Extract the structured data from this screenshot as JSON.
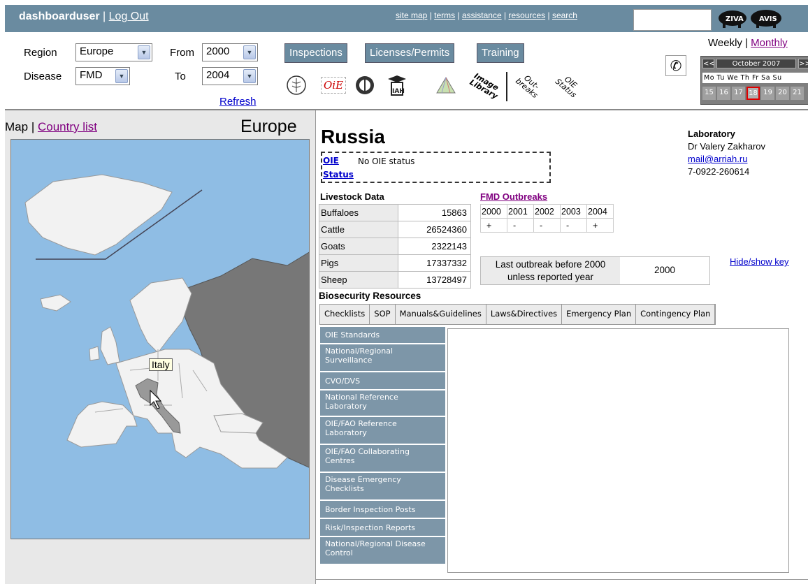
{
  "header": {
    "username": "dashboarduser",
    "separator": "|",
    "logout": "Log Out",
    "links": [
      "site map",
      "terms",
      "assistance",
      "resources",
      "search"
    ],
    "logo_text_1": "ZIVA",
    "logo_text_2": "AVIS"
  },
  "filters": {
    "region_label": "Region",
    "region_value": "Europe",
    "disease_label": "Disease",
    "disease_value": "FMD",
    "from_label": "From",
    "from_value": "2000",
    "to_label": "To",
    "to_value": "2004",
    "refresh": "Refresh"
  },
  "tabs": [
    "Inspections",
    "Licenses/Permits",
    "Training"
  ],
  "icon_labels": {
    "fao": "FAO",
    "oie": "OiE",
    "who": "WHO",
    "iah": "IAH",
    "image_library": "Image Library",
    "outbreaks": "Out-breaks",
    "oie_status": "OIE Status"
  },
  "calendar": {
    "weekly": "Weekly",
    "sep": "|",
    "monthly": "Monthly",
    "prev": "<<",
    "next": ">>",
    "month": "October 2007",
    "dow": "Mo Tu We Th Fr Sa Su",
    "days": [
      "15",
      "16",
      "17",
      "18",
      "19",
      "20",
      "21"
    ],
    "today_index": 3
  },
  "map_panel": {
    "map_label": "Map",
    "sep": "|",
    "country_list": "Country list",
    "region_title": "Europe",
    "tooltip": "Italy"
  },
  "country": {
    "name": "Russia",
    "oie_link": "OIE",
    "status_link": "Status",
    "oie_status": "No OIE status"
  },
  "laboratory": {
    "title": "Laboratory",
    "person": "Dr Valery Zakharov",
    "email": "mail@arriah.ru",
    "phone": "7-0922-260614"
  },
  "livestock": {
    "title": "Livestock Data",
    "rows": [
      {
        "name": "Buffaloes",
        "value": "15863"
      },
      {
        "name": "Cattle",
        "value": "26524360"
      },
      {
        "name": "Goats",
        "value": "2322143"
      },
      {
        "name": "Pigs",
        "value": "17337332"
      },
      {
        "name": "Sheep",
        "value": "13728497"
      }
    ]
  },
  "outbreaks": {
    "title": "FMD Outbreaks",
    "years": [
      "2000",
      "2001",
      "2002",
      "2003",
      "2004"
    ],
    "marks": [
      "+",
      "-",
      "-",
      "-",
      "+"
    ],
    "last_label_1": "Last outbreak before 2000",
    "last_label_2": "unless reported year",
    "last_value": "2000",
    "hide_show": "Hide/show key"
  },
  "biosecurity": {
    "title": "Biosecurity Resources",
    "tabs": [
      "Checklists",
      "SOP",
      "Manuals&Guidelines",
      "Laws&Directives",
      "Emergency Plan",
      "Contingency Plan"
    ],
    "items": [
      "OIE Standards",
      "National/Regional Surveillance",
      "CVO/DVS",
      "National Reference Laboratory",
      "OIE/FAO Reference Laboratory",
      "OIE/FAO Collaborating Centres",
      "Disease Emergency Checklists",
      "Border Inspection Posts",
      "Risk/Inspection Reports",
      "National/Regional Disease Control"
    ]
  }
}
